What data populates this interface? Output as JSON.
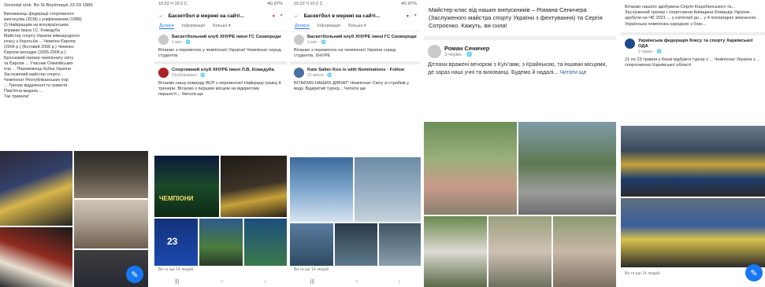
{
  "panel1": {
    "header_text": "Sociodal s/ok. Bo St Beyimepyk 23 03 1989",
    "body_lines": [
      "Вихованець федерації спортивного",
      "мистецтва (ЗСМ) з уніфікованим (1988)",
      "2) Найкращим на всеукраїнських",
      "вправах Івана І.С. Кожедуба",
      "Майстер спорту України міжнародного",
      "класу з боротьби ... Чемпіон Європи",
      "(2004 р.) (Ботовий 2006 р.) Чемпіон",
      "Європи молодих (2005-2006 р.)",
      "Бронзовий призер чемпіонату світу",
      "та Європи ... Учасник Олімпійських",
      "ігор ... Переможець Кубка України",
      "Заслужений майстер спорту...",
      "Чемпіонат Республіканських ігор",
      "... Тренер відділення та грамоти.",
      "Пам'ятна медаль ..."
    ],
    "footer_text": "Так тримати!"
  },
  "panel2": {
    "status_time": "10:22 Ч 10:2 С",
    "status_right": "4G 87%",
    "title": "Баскетбол в мережі на сайті...",
    "tabs": [
      "Дописи",
      "Інформація",
      "Більше ▾"
    ],
    "post1": {
      "name": "Баскетбольний клуб ХНУРЕ імені ГС Сковороди",
      "meta": "1 квіт. · 🌐",
      "text": "Вітаємо з перемогою у чемпіонаті України! Чемпіонат серед студентів"
    },
    "post2": {
      "name": "Спортивний клуб ХНУРЕ імені Л.В. Кожедуба",
      "meta": "Опубліковано · 🌐",
      "text": "Вітаємо нашу команду ВСР з перемогою! Найкращі гравці й тренери. Вітаємо з першим місцем на відкритому першості... Читати ще"
    },
    "banner_text": "ЧЕМПІОНИ",
    "score": "23",
    "footer": "Ви та ще 14 людей"
  },
  "panel3": {
    "status_time": "10:22 Ч 10:2 С",
    "status_right": "4G 87%",
    "title": "Баскетбол в мережі на сайті...",
    "tabs": [
      "Дописи",
      "Інформація",
      "Більше ▾"
    ],
    "post1": {
      "name": "Баскетбольний клуб ХНУРЕ імені ГС Сковороди",
      "meta": "1 квіт. · 🌐",
      "text": "Вітаємо з перемогою на чемпіонаті України серед студентів, ХНУРЕ"
    },
    "post2": {
      "name": "Kate Salter-Kos is with Nominations · Follow",
      "meta": "22 квітня · 🌐",
      "text": "ВІТАЄМО НАШИХ ДІВЧАТ! Чемпіонат Світу зі стрибків у воду. Відкритий турнір... Читати ще"
    },
    "footer": "Ви та ще 14 людей"
  },
  "panel4": {
    "top_text": "Майстер-клас від наших випускників – Романа Сеничера (Заслуженого майстра спорту України з фехтування) та Сергія Сотроєнко. Кажуть, ви сила!",
    "post": {
      "name": "Роман Сеничер",
      "meta": "3 червн. · 🌐",
      "text": "Дітлахи вражені вечором з Kyiv'ами, з Крайнькою, та іншими місцями, де зараз наші учні та вихованці. Будемо й надалі..."
    },
    "more_link": "Читати ще"
  },
  "panel5": {
    "top_text": "Вітаємо нашого здобувача Сергія Коцюбинського та... Заслужений тренер і спортсмени Київщини Команда України... здобули на ЧЄ 2021 ... у категорії до... у 4 попередніх змаганнях... Українська чемпіонка народних з бокс...",
    "post": {
      "name": "Українська федерація боксу та спорту Харківської ОДА",
      "meta": "2 червн. · 🌐",
      "text": "21 по 23 травня у Києві відбувся турнір з ... Чемпіонат України з ... спортсменки Харківської області"
    },
    "footer": "Ви та ще 14 людей"
  },
  "colors": {
    "accent": "#1877f2",
    "fb_link": "#385898"
  }
}
